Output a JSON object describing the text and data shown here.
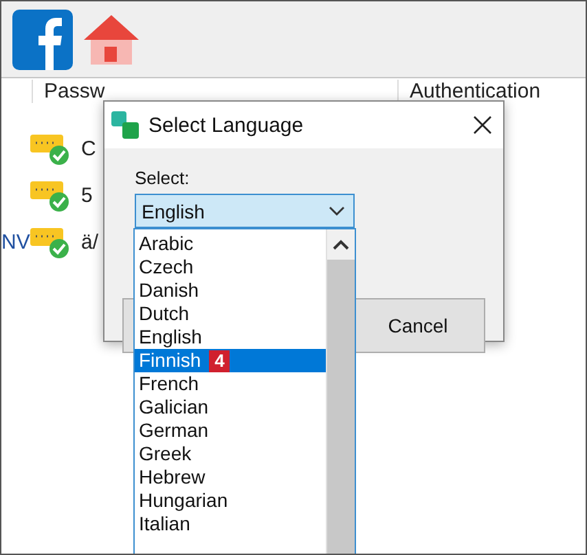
{
  "toolbar": {
    "icons": [
      {
        "kind": "facebook"
      },
      {
        "kind": "home"
      }
    ]
  },
  "table": {
    "columns": [
      "Passw",
      "Authentication"
    ],
    "rows": [
      {
        "lead": "",
        "cell": "C"
      },
      {
        "lead": "",
        "cell": "5"
      },
      {
        "lead": "NV",
        "cell": "ä/"
      }
    ]
  },
  "dialog": {
    "title": "Select Language",
    "label": "Select:",
    "combo_value": "English",
    "options": [
      {
        "label": "Arabic",
        "selected": false
      },
      {
        "label": "Czech",
        "selected": false
      },
      {
        "label": "Danish",
        "selected": false
      },
      {
        "label": "Dutch",
        "selected": false
      },
      {
        "label": "English",
        "selected": false
      },
      {
        "label": "Finnish",
        "selected": true,
        "badge": "4"
      },
      {
        "label": "French",
        "selected": false
      },
      {
        "label": "Galician",
        "selected": false
      },
      {
        "label": "German",
        "selected": false
      },
      {
        "label": "Greek",
        "selected": false
      },
      {
        "label": "Hebrew",
        "selected": false
      },
      {
        "label": "Hungarian",
        "selected": false
      },
      {
        "label": "Italian",
        "selected": false
      }
    ],
    "cancel": "Cancel"
  }
}
